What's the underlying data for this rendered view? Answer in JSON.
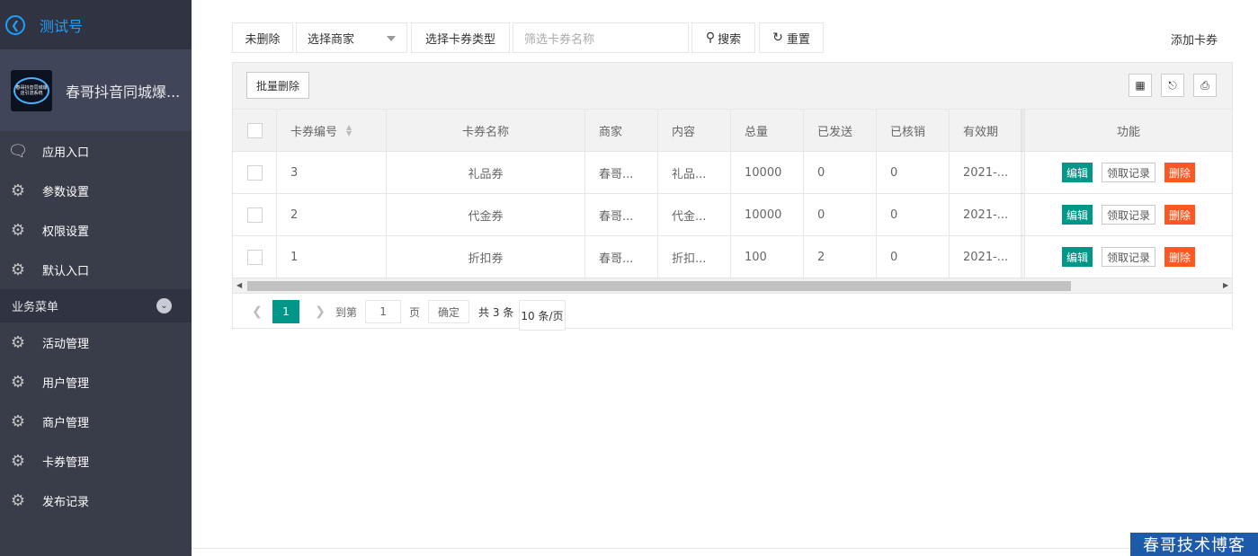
{
  "sidebar": {
    "title": "测试号",
    "shop_name": "春哥抖音同城爆...",
    "logo_text": "春哥抖音同城爆店引流系统",
    "items_top": [
      {
        "label": "应用入口",
        "icon": "chat-icon"
      },
      {
        "label": "参数设置",
        "icon": "gear-icon"
      },
      {
        "label": "权限设置",
        "icon": "gear-icon"
      },
      {
        "label": "默认入口",
        "icon": "gear-icon"
      }
    ],
    "group_label": "业务菜单",
    "items_group": [
      {
        "label": "活动管理",
        "icon": "gear-icon"
      },
      {
        "label": "用户管理",
        "icon": "gear-icon"
      },
      {
        "label": "商户管理",
        "icon": "gear-icon"
      },
      {
        "label": "卡券管理",
        "icon": "gear-icon"
      },
      {
        "label": "发布记录",
        "icon": "gear-icon"
      }
    ]
  },
  "toolbar": {
    "status_select": "未删除",
    "merchant_select": "选择商家",
    "type_select": "选择卡券类型",
    "search_placeholder": "筛选卡券名称",
    "search_label": "搜索",
    "reset_label": "重置",
    "add_label": "添加卡券"
  },
  "table": {
    "batch_delete": "批量删除",
    "columns": [
      "卡券编号",
      "卡券名称",
      "商家",
      "内容",
      "总量",
      "已发送",
      "已核销",
      "有效期",
      "功能"
    ],
    "rows": [
      {
        "id": "3",
        "name": "礼品券",
        "merchant": "春哥...",
        "content": "礼品...",
        "total": "10000",
        "sent": "0",
        "verified": "0",
        "valid": "2021-..."
      },
      {
        "id": "2",
        "name": "代金券",
        "merchant": "春哥...",
        "content": "代金...",
        "total": "10000",
        "sent": "0",
        "verified": "0",
        "valid": "2021-..."
      },
      {
        "id": "1",
        "name": "折扣券",
        "merchant": "春哥...",
        "content": "折扣...",
        "total": "100",
        "sent": "2",
        "verified": "0",
        "valid": "2021-..."
      }
    ],
    "actions": {
      "edit": "编辑",
      "log": "领取记录",
      "delete": "删除"
    }
  },
  "pager": {
    "current": "1",
    "goto_label": "到第",
    "goto_value": "1",
    "page_unit": "页",
    "confirm": "确定",
    "total": "共 3 条",
    "page_size": "10 条/页"
  },
  "watermark": "春哥技术博客",
  "colors": {
    "sidebar": "#393d49",
    "accent": "#009688",
    "danger": "#ff5722",
    "link": "#1e9fff"
  }
}
